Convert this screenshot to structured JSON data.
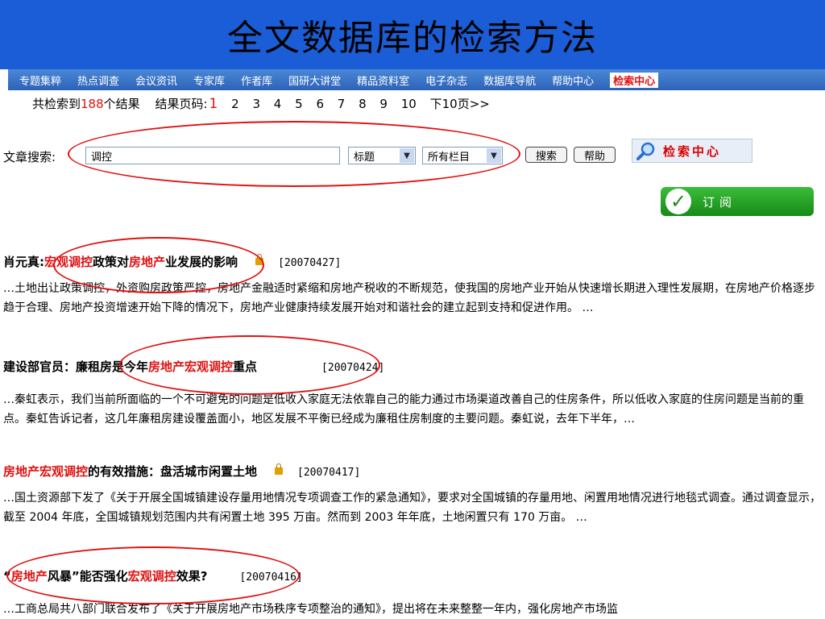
{
  "slide_title": "全文数据库的检索方法",
  "nav": {
    "items": [
      {
        "label": "专题集粹"
      },
      {
        "label": "热点调查"
      },
      {
        "label": "会议资讯"
      },
      {
        "label": "专家库"
      },
      {
        "label": "作者库"
      },
      {
        "label": "国研大讲堂"
      },
      {
        "label": "精品资料室"
      },
      {
        "label": "电子杂志"
      },
      {
        "label": "数据库导航"
      },
      {
        "label": "帮助中心"
      },
      {
        "label": "检索中心"
      }
    ]
  },
  "results": {
    "prefix": "共检索到",
    "count": "188",
    "suffix": "个结果",
    "pages_label": "结果页码:",
    "pages": [
      "1",
      "2",
      "3",
      "4",
      "5",
      "6",
      "7",
      "8",
      "9",
      "10"
    ],
    "next": "下10页>>"
  },
  "search": {
    "label": "文章搜索:",
    "keyword": "调控",
    "field": "标题",
    "column": "所有栏目",
    "search_btn": "搜索",
    "help_btn": "帮助",
    "center_label": "检索中心"
  },
  "subscribe_label": "订阅",
  "articles": [
    {
      "t1": "肖元真:",
      "t2": "宏观调控",
      "t3": "政策对",
      "t4": "房地产",
      "t5": "业发展的影响",
      "date": "[20070427]",
      "snippet": "…土地出让政策调控，外资购房政策严控，房地产金融适时紧缩和房地产税收的不断规范，使我国的房地产业开始从快速增长期进入理性发展期，在房地产价格逐步趋于合理、房地产投资增速开始下降的情况下，房地产业健康持续发展开始对和谐社会的建立起到支持和促进作用。 …"
    },
    {
      "t1": "建设部官员：廉租房是今年",
      "t2": "房地产宏观调控",
      "t3": "重点",
      "date": "[20070424]",
      "snippet": "…秦虹表示，我们当前所面临的一个不可避免的问题是低收入家庭无法依靠自己的能力通过市场渠道改善自己的住房条件，所以低收入家庭的住房问题是当前的重点。秦虹告诉记者，这几年廉租房建设覆盖面小，地区发展不平衡已经成为廉租住房制度的主要问题。秦虹说，去年下半年，…"
    },
    {
      "t1": "房地产宏观调控",
      "t2": "的有效措施：盘活城市闲置土地",
      "date": "[20070417]",
      "snippet": "…国土资源部下发了《关于开展全国城镇建设存量用地情况专项调查工作的紧急通知》，要求对全国城镇的存量用地、闲置用地情况进行地毯式调查。通过调查显示，截至 2004 年底，全国城镇规划范围内共有闲置土地 395 万亩。然而到 2003 年年底，土地闲置只有 170 万亩。 …"
    },
    {
      "t1": "“",
      "t2": "房地产",
      "t3": "风暴”能否强化",
      "t4": "宏观调控",
      "t5": "效果?",
      "date": "[20070416]",
      "snippet": "…工商总局共八部门联合发布了《关于开展房地产市场秩序专项整治的通知》，提出将在未来整整一年内，强化房地产市场监"
    }
  ]
}
